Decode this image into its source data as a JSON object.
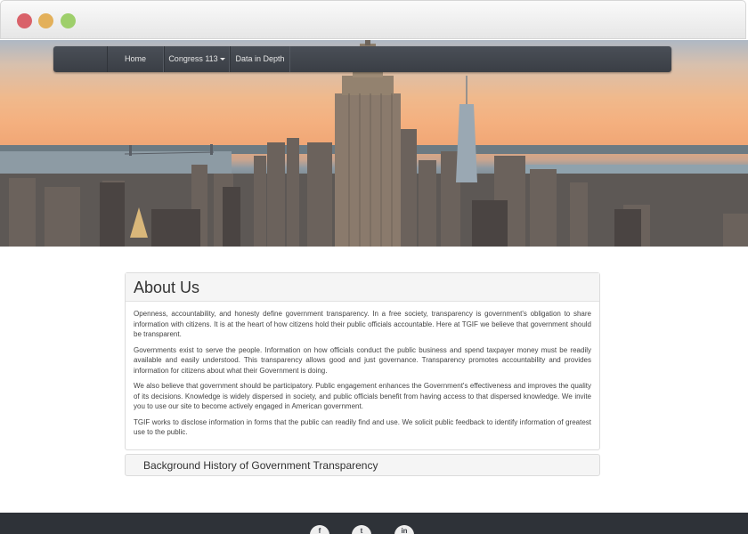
{
  "window": {
    "controls": [
      "close",
      "minimize",
      "maximize"
    ]
  },
  "nav": {
    "items": [
      {
        "label": "Home"
      },
      {
        "label": "Congress 113",
        "has_dropdown": true
      },
      {
        "label": "Data in Depth"
      }
    ]
  },
  "about": {
    "title": "About Us",
    "paragraphs": [
      "Openness, accountability, and honesty define government transparency. In a free society, transparency is government's obligation to share information with citizens. It is at the heart of how citizens hold their public officials accountable. Here at TGIF we believe that government should be transparent.",
      "Governments exist to serve the people. Information on how officials conduct the public business and spend taxpayer money must be readily available and easily understood. This transparency allows good and just governance. Transparency promotes accountability and provides information for citizens about what their Government is doing.",
      "We also believe that government should be participatory. Public engagement enhances the Government's effectiveness and improves the quality of its decisions. Knowledge is widely dispersed in society, and public officials benefit from having access to that dispersed knowledge. We invite you to use our site to become actively engaged in American government.",
      "TGIF works to disclose information in forms that the public can readily find and use. We solicit public feedback to identify information of greatest use to the public."
    ]
  },
  "background": {
    "title": "Background History of Government Transparency"
  },
  "footer": {
    "social": [
      {
        "icon": "facebook-icon",
        "glyph": "f"
      },
      {
        "icon": "twitter-icon",
        "glyph": "t"
      },
      {
        "icon": "linkedin-icon",
        "glyph": "in"
      }
    ]
  },
  "colors": {
    "navbar": "#3f444b",
    "footer": "#2e3238",
    "close": "#d9626a",
    "minimize": "#e3b05a",
    "maximize": "#9ecf6b"
  }
}
